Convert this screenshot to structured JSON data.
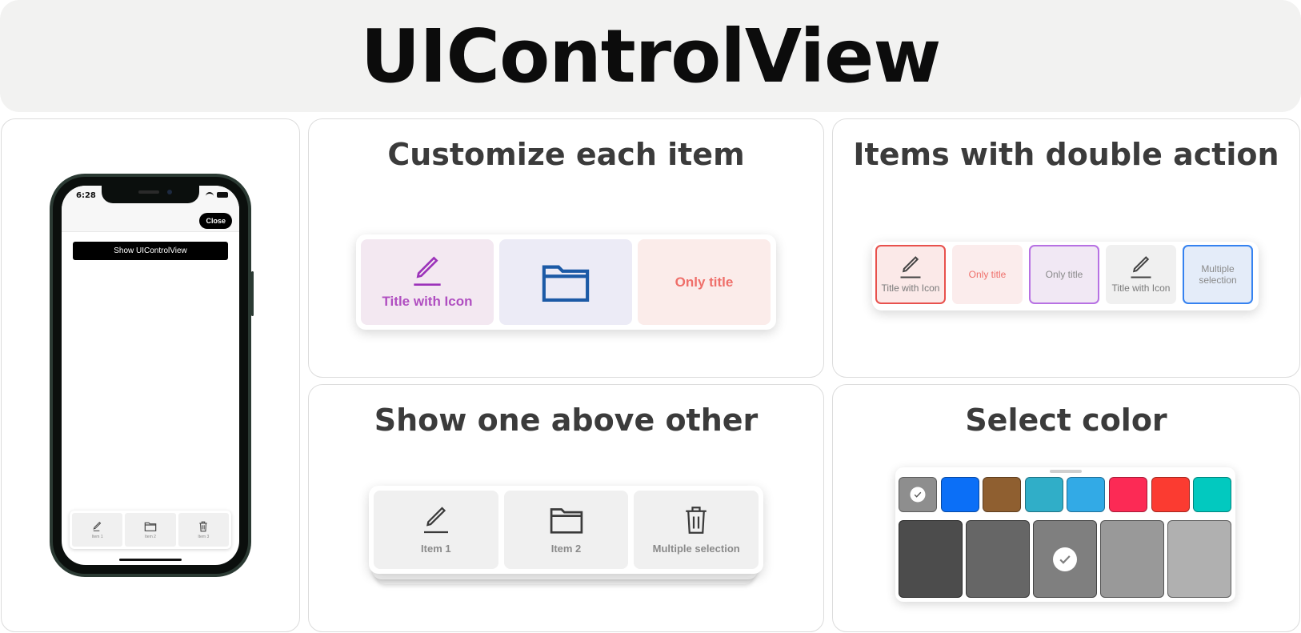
{
  "title": "UIControlView",
  "phone": {
    "time": "6:28",
    "close_label": "Close",
    "show_button_label": "Show UIControlView",
    "items": [
      {
        "label": "Item 1",
        "icon": "pencil-icon"
      },
      {
        "label": "Item 2",
        "icon": "folder-icon"
      },
      {
        "label": "Item 3",
        "icon": "trash-icon"
      }
    ]
  },
  "customize": {
    "title": "Customize each item",
    "items": [
      {
        "label": "Title with Icon",
        "icon": "pencil-icon",
        "bg": "#f3e8f1",
        "color": "#b04fc1"
      },
      {
        "label": "",
        "icon": "folder-icon",
        "bg": "#ecebf6",
        "color": "#1c5aa6"
      },
      {
        "label": "Only title",
        "icon": "",
        "bg": "#fbecea",
        "color": "#ef6f6a"
      }
    ]
  },
  "double_action": {
    "title": "Items with double action",
    "items": [
      {
        "label": "Title with Icon",
        "icon": "pencil-icon",
        "bg": "#fbe9e8",
        "border": "#e8514d",
        "color": "#7a7a7a"
      },
      {
        "label": "Only title",
        "icon": "",
        "bg": "#fbecec",
        "border": "",
        "color": "#ef6f6a"
      },
      {
        "label": "Only title",
        "icon": "",
        "bg": "#f1e8f4",
        "border": "#b771e3",
        "color": "#8a8a8a"
      },
      {
        "label": "Title with Icon",
        "icon": "pencil-icon",
        "bg": "#f0f0f0",
        "border": "",
        "color": "#7a7a7a"
      },
      {
        "label": "Multiple selection",
        "icon": "",
        "bg": "#e4ecf9",
        "border": "#3582f0",
        "color": "#8a8a8a"
      }
    ]
  },
  "above_other": {
    "title": "Show one above other",
    "items": [
      {
        "label": "Item 1",
        "icon": "pencil-icon"
      },
      {
        "label": "Item 2",
        "icon": "folder-icon"
      },
      {
        "label": "Multiple selection",
        "icon": "trash-icon"
      }
    ]
  },
  "select_color": {
    "title": "Select color",
    "top_swatches": [
      {
        "color": "#8e8e8e",
        "selected": true
      },
      {
        "color": "#0b6ff7",
        "selected": false
      },
      {
        "color": "#8f5f30",
        "selected": false
      },
      {
        "color": "#30aec8",
        "selected": false
      },
      {
        "color": "#32aae6",
        "selected": false
      },
      {
        "color": "#fc2a55",
        "selected": false
      },
      {
        "color": "#fb3b31",
        "selected": false
      },
      {
        "color": "#02c9bf",
        "selected": false
      }
    ],
    "shades": [
      {
        "color": "#4c4c4c",
        "selected": false
      },
      {
        "color": "#666666",
        "selected": false
      },
      {
        "color": "#7f7f7f",
        "selected": true
      },
      {
        "color": "#999999",
        "selected": false
      },
      {
        "color": "#b0b0b0",
        "selected": false
      }
    ]
  }
}
